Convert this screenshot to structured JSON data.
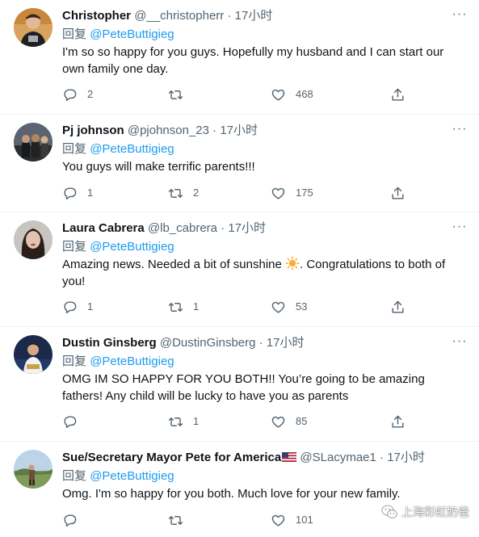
{
  "tweets": [
    {
      "name": "Christopher",
      "handle": "@__christopherr",
      "sep": "·",
      "time": "17小时",
      "reply_prefix": "回复",
      "reply_to": "@PeteButtigieg",
      "text": "I'm so so happy for you guys. Hopefully my husband and I can start our own family one day.",
      "replies": "2",
      "retweets": "",
      "likes": "468"
    },
    {
      "name": "Pj johnson",
      "handle": "@pjohnson_23",
      "sep": "·",
      "time": "17小时",
      "reply_prefix": "回复",
      "reply_to": "@PeteButtigieg",
      "text": "You guys will make terrific parents!!!",
      "replies": "1",
      "retweets": "2",
      "likes": "175"
    },
    {
      "name": "Laura Cabrera",
      "handle": "@lb_cabrera",
      "sep": "·",
      "time": "17小时",
      "reply_prefix": "回复",
      "reply_to": "@PeteButtigieg",
      "text_before_emoji": "Amazing news. Needed a bit of sunshine ",
      "emoji": "sun-emoji",
      "text_after_emoji": ". Congratulations to both of you!",
      "replies": "1",
      "retweets": "1",
      "likes": "53"
    },
    {
      "name": "Dustin Ginsberg",
      "handle": "@DustinGinsberg",
      "sep": "·",
      "time": "17小时",
      "reply_prefix": "回复",
      "reply_to": "@PeteButtigieg",
      "text": "OMG IM SO HAPPY FOR YOU BOTH!! You’re going to be amazing fathers! Any child will be lucky to have you as parents",
      "replies": "",
      "retweets": "1",
      "likes": "85"
    },
    {
      "name": "Sue/Secretary Mayor Pete for America",
      "flag": "us-flag-emoji",
      "handle": "@SLacymae1",
      "sep": "·",
      "time": "17小时",
      "reply_prefix": "回复",
      "reply_to": "@PeteButtigieg",
      "text": "Omg. I'm so happy for you both. Much love for your new family.",
      "replies": "",
      "retweets": "",
      "likes": "101"
    }
  ],
  "more_glyph": "···",
  "watermark": {
    "icon": "wechat-icon",
    "text": "上海彩虹奶爸"
  },
  "colors": {
    "link": "#1d9bf0",
    "muted": "#536471",
    "text": "#0f1419",
    "divider": "#eff3f4"
  }
}
